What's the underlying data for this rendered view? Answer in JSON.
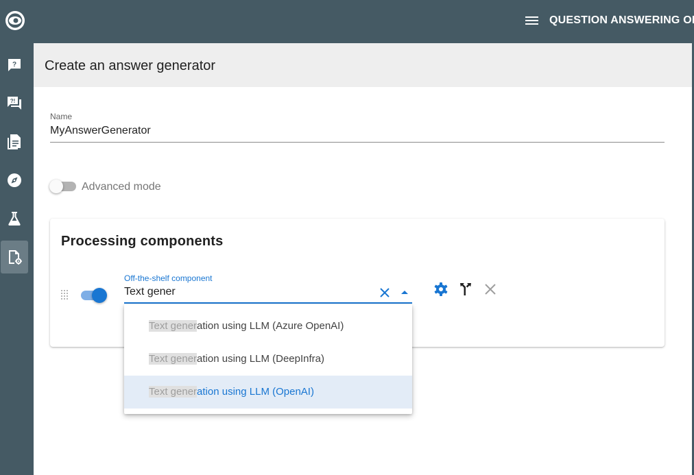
{
  "header": {
    "title": "QUESTION ANSWERING ON M",
    "menu_icon": "hamburger-menu-icon"
  },
  "rail": {
    "logo_icon": "app-logo-icon",
    "items": [
      {
        "name": "question",
        "icon": "question-chat-icon",
        "active": false
      },
      {
        "name": "faq",
        "icon": "qa-forum-icon",
        "active": false
      },
      {
        "name": "documents",
        "icon": "documents-icon",
        "active": false
      },
      {
        "name": "explore",
        "icon": "compass-icon",
        "active": false
      },
      {
        "name": "experiments",
        "icon": "flask-icon",
        "active": false
      },
      {
        "name": "settings",
        "icon": "document-settings-icon",
        "active": true
      }
    ]
  },
  "page": {
    "title": "Create an answer generator"
  },
  "form": {
    "name_label": "Name",
    "name_value": "MyAnswerGenerator",
    "advanced_label": "Advanced mode",
    "advanced_on": false
  },
  "card": {
    "title": "Processing components",
    "component": {
      "enabled": true,
      "label": "Off-the-shelf component",
      "value": "Text gener",
      "actions": [
        "settings-gear-icon",
        "fork-icon",
        "remove-icon"
      ]
    }
  },
  "dropdown": {
    "query": "Text gener",
    "options": [
      {
        "match": "Text gener",
        "rest": "ation using LLM (Azure OpenAI)",
        "selected": false
      },
      {
        "match": "Text gener",
        "rest": "ation using LLM (DeepInfra)",
        "selected": false
      },
      {
        "match": "Text gener",
        "rest": "ation using LLM (OpenAI)",
        "selected": true
      }
    ]
  },
  "colors": {
    "primary": "#1976d2",
    "appbar": "#455a64",
    "header_bg": "#eeeeee"
  }
}
